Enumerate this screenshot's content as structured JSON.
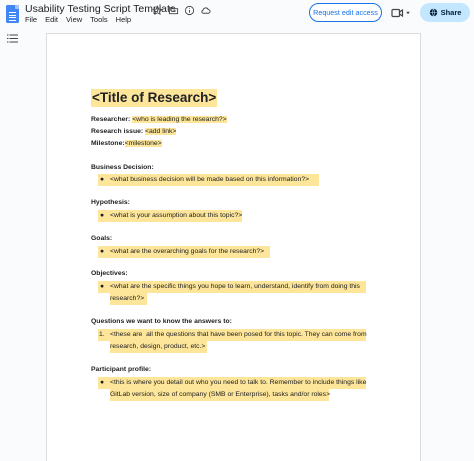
{
  "header": {
    "doc_title": "Usability Testing Script Template",
    "menu": [
      "File",
      "Edit",
      "View",
      "Tools",
      "Help"
    ],
    "request_edit_label": "Request edit access",
    "share_label": "Share"
  },
  "document": {
    "heading": "<Title of Research>",
    "meta": [
      {
        "label": "Researcher:",
        "value": "<who is leading the research?>"
      },
      {
        "label": "Research issue:",
        "value": "<add link>"
      },
      {
        "label": "Milestone:",
        "value": "<milestone>"
      }
    ],
    "sections": [
      {
        "label": "Business Decision:",
        "lines": [
          "<what business decision will be made based on this information?>"
        ]
      },
      {
        "label": "Hypothesis:",
        "lines": [
          "<what is your assumption about this topic?>"
        ]
      },
      {
        "label": "Goals:",
        "lines": [
          "<what are the overarching goals for the research?>"
        ]
      },
      {
        "label": "Objectives:",
        "lines": [
          "<what are the specific things you hope to learn, understand, identify from doing this",
          "research?>"
        ]
      },
      {
        "label": "Questions we want to know the answers to:",
        "number": "1.",
        "lines": [
          "<these are  all the questions that have been posed for this topic. They can come from",
          "research, design, product, etc.>"
        ]
      },
      {
        "label": "Participant profile:",
        "lines": [
          "<this is where you detail out who you need to talk to. Remember to include things like",
          "GitLab version, size of company (SMB or Enterprise), tasks and/or roles>"
        ]
      }
    ]
  },
  "colors": {
    "highlight": "#fde599",
    "accent": "#1a73e8",
    "share_bg": "#c2e7ff"
  },
  "icons": [
    "docs-logo-icon",
    "star-icon",
    "move-to-folder-icon",
    "info-icon",
    "cloud-status-icon",
    "video-call-icon",
    "chevron-down-icon",
    "globe-icon",
    "outline-icon"
  ]
}
